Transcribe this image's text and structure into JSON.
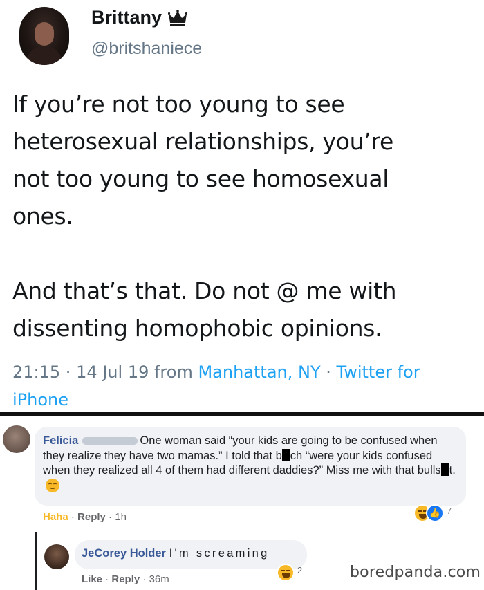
{
  "tweet": {
    "name": "Brittany",
    "handle": "@britshaniece",
    "text_lines": [
      "If you’re not too young to see",
      "heterosexual relationships, you’re",
      "not too young to see homosexual",
      "ones."
    ],
    "text_lines_2": [
      "And that’s that. Do not @ me with",
      "dissenting homophobic opinions."
    ],
    "meta": {
      "time": "21:15",
      "sep1": " · ",
      "date": "14 Jul 19 from ",
      "location": "Manhattan, NY",
      "sep2": " · ",
      "source": "Twitter for iPhone"
    }
  },
  "comment_1": {
    "name": "Felicia",
    "text_a": "One woman said “your kids are going to be confused when they realize they have two mamas.” I told that b",
    "text_b": "ch “were your kids confused when they realized all 4 of them had different daddies?” Miss me with that bulls",
    "text_c": "t.",
    "actions": {
      "haha": "Haha",
      "dot1": " · ",
      "reply": "Reply",
      "dot2": " · ",
      "time": "1h"
    },
    "reaction_count": "7"
  },
  "comment_2": {
    "name": "JeCorey Holder",
    "text": "I'm screaming",
    "actions": {
      "like": "Like",
      "dot1": " · ",
      "reply": "Reply",
      "dot2": " · ",
      "time": "36m"
    },
    "reaction_count": "2"
  },
  "watermark": "boredpanda.com",
  "colors": {
    "twitter_blue": "#1da1f2",
    "twitter_gray": "#657786",
    "fb_name_blue": "#385898",
    "fb_bubble": "#f0f2f5",
    "haha_yellow": "#f7b928"
  }
}
